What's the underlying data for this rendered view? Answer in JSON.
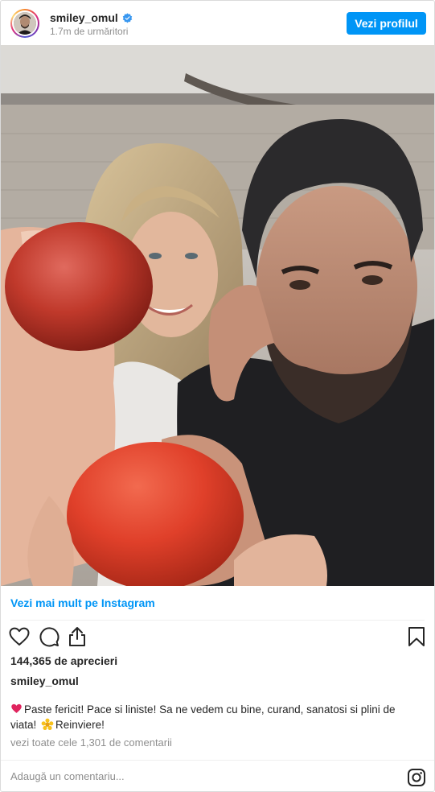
{
  "header": {
    "username": "smiley_omul",
    "verified": true,
    "followers": "1.7m de urmăritori",
    "profile_button": "Vezi profilul"
  },
  "photo": {
    "description_icon": "post-photo"
  },
  "more_link": "Vezi mai mult pe Instagram",
  "actions": {
    "icons": [
      "heart-icon",
      "comment-icon",
      "share-icon",
      "bookmark-icon"
    ]
  },
  "likes": "144,365 de aprecieri",
  "caption": {
    "username": "smiley_omul",
    "text_part1": "Paste fericit! Pace si liniste! Sa ne vedem cu bine, curand, sanatosi si plini de viata!",
    "text_part2": "Reinviere!"
  },
  "comments_link": "vezi toate cele 1,301 de comentarii",
  "comment_box": {
    "placeholder": "Adaugă un comentariu..."
  },
  "colors": {
    "accent": "#0095f6",
    "muted": "#8e8e8e",
    "text": "#262626",
    "border": "#dbdbdb"
  }
}
